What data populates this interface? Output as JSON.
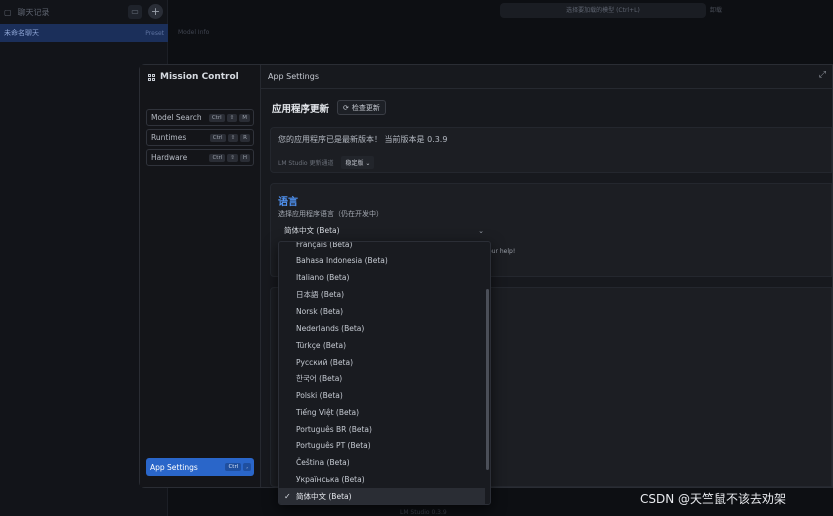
{
  "background": {
    "sidebar_title": "聊天记录",
    "active_chat": "未命名聊天",
    "active_chat_badge": "Preset",
    "model_selector": "选择要加载的模型 (Ctrl+L)",
    "eject_label": "卸载",
    "hint": "Model Info",
    "footer": "LM Studio 0.3.9"
  },
  "mission_control": {
    "title": "Mission Control",
    "items": [
      {
        "label": "Model Search",
        "keys": [
          "Ctrl",
          "⇧",
          "M"
        ]
      },
      {
        "label": "Runtimes",
        "keys": [
          "Ctrl",
          "⇧",
          "R"
        ]
      },
      {
        "label": "Hardware",
        "keys": [
          "Ctrl",
          "⇧",
          "H"
        ]
      }
    ],
    "app_settings": {
      "label": "App Settings",
      "keys": [
        "Ctrl",
        ","
      ]
    }
  },
  "settings": {
    "header": "App Settings",
    "update_title": "应用程序更新",
    "check_update_button": "检查更新",
    "update_status": "您的应用程序已是最新版本！ 当前版本是 0.3.9",
    "channel_label": "LM Studio 更新通道",
    "channel_value": "稳定版",
    "language_title": "语言",
    "language_desc": "选择应用程序语言（仍在开发中）",
    "language_selected": "简体中文 (Beta)",
    "help_tail": "our help!"
  },
  "dropdown": {
    "options": [
      "Français (Beta)",
      "Bahasa Indonesia (Beta)",
      "Italiano (Beta)",
      "日本語 (Beta)",
      "Norsk (Beta)",
      "Nederlands (Beta)",
      "Türkçe (Beta)",
      "Русский (Beta)",
      "한국어 (Beta)",
      "Polski (Beta)",
      "Tiếng Việt (Beta)",
      "Português BR (Beta)",
      "Português PT (Beta)",
      "Čeština (Beta)",
      "Українська (Beta)",
      "简体中文 (Beta)"
    ],
    "selected_index": 15,
    "check_glyph": "✓"
  },
  "watermark": "CSDN @天竺鼠不该去劝架",
  "colors": {
    "accent": "#2a66c9",
    "language_title": "#4f91f0",
    "background": "#0d0f13"
  }
}
